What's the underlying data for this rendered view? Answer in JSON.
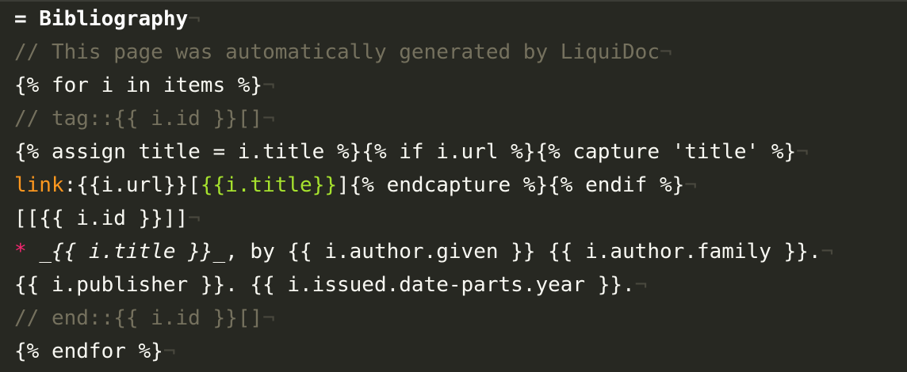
{
  "editor": {
    "eol_marker": "¬",
    "lines": [
      {
        "heading": "= Bibliography"
      },
      {
        "comment": "// This page was automatically generated by LiquiDoc"
      },
      {
        "text": "{% for i in items %}"
      },
      {
        "comment": "// tag::{{ i.id }}[]"
      },
      {
        "text": "{% assign title = i.title %}{% if i.url %}{% capture 'title' %}"
      },
      {
        "macro": "link",
        "after_macro": ":{{i.url}}[",
        "link_text": "{{i.title}}",
        "after_link": "]{% endcapture %}{% endif %}"
      },
      {
        "text": "[[{{ i.id }}]]"
      },
      {
        "bullet": "*",
        "space": " ",
        "italic": "_{{ i.title }}_",
        "rest": ", by {{ i.author.given }} {{ i.author.family }}."
      },
      {
        "text": "{{ i.publisher }}. {{ i.issued.date-parts.year }}."
      },
      {
        "comment": "// end::{{ i.id }}[]"
      },
      {
        "text": "{% endfor %}"
      }
    ]
  },
  "colors": {
    "background": "#272822",
    "text": "#f8f8f2",
    "comment": "#75715e",
    "link_macro": "#fd971f",
    "link_text": "#a6e22e",
    "bullet": "#f92672"
  }
}
